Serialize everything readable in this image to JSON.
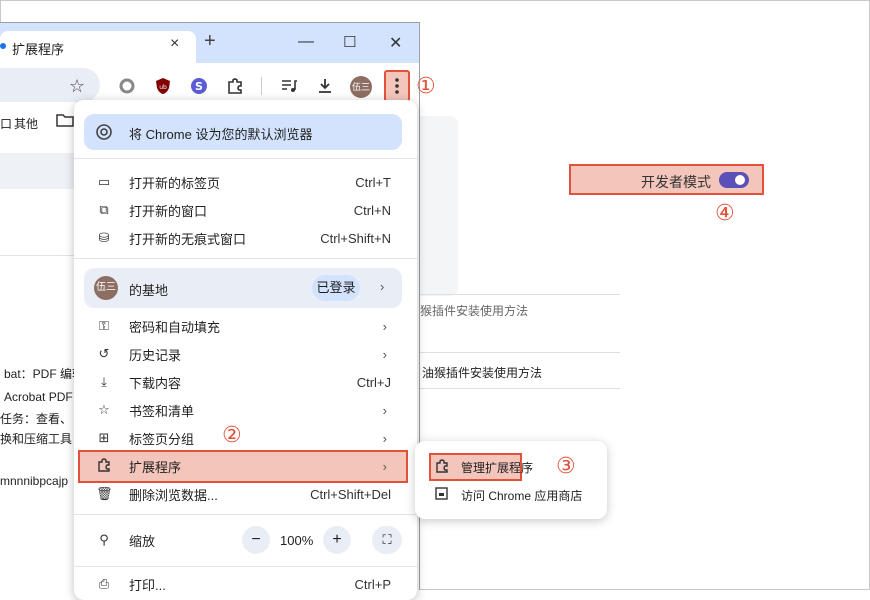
{
  "browser": {
    "tab_title": "扩展程序",
    "tab_close": "×",
    "new_tab": "+",
    "minimize": "—",
    "maximize": "☐",
    "close": "✕",
    "bookmarks_other": "其他",
    "bookmark_prefix": "口",
    "avatar_text": "伍三"
  },
  "annotations": {
    "step1": "①",
    "step2": "②",
    "step3": "③",
    "step4": "④"
  },
  "menu": {
    "set_default": "将 Chrome 设为您的默认浏览器",
    "new_tab": "打开新的标签页",
    "new_tab_shortcut": "Ctrl+T",
    "new_window": "打开新的窗口",
    "new_window_shortcut": "Ctrl+N",
    "incognito": "打开新的无痕式窗口",
    "incognito_shortcut": "Ctrl+Shift+N",
    "profile_name": "的基地",
    "signed_in": "已登录",
    "passwords": "密码和自动填充",
    "history": "历史记录",
    "downloads": "下载内容",
    "downloads_shortcut": "Ctrl+J",
    "bookmarks": "书签和清单",
    "tab_groups": "标签页分组",
    "extensions": "扩展程序",
    "clear_data": "删除浏览数据...",
    "clear_data_shortcut": "Ctrl+Shift+Del",
    "zoom_label": "缩放",
    "zoom_value": "100%",
    "zoom_minus": "−",
    "zoom_plus": "+",
    "print": "打印...",
    "print_shortcut": "Ctrl+P"
  },
  "submenu": {
    "manage": "管理扩展程序",
    "webstore": "访问 Chrome 应用商店"
  },
  "page": {
    "dev_mode": "开发者模式",
    "text1": "猴插件安装使用方法",
    "text2": "油猴插件安装使用方法",
    "left1": "bat：PDF 编辑",
    "left2": "Acrobat PDF",
    "left3": "任务：查看、",
    "left4": "换和压缩工具",
    "left5": "mnnnibpcajp"
  },
  "colors": {
    "highlight_fill": "#f3c5bb",
    "highlight_border": "#e0533a",
    "accent": "#1a73e8",
    "toggle": "#5b4fb8"
  }
}
